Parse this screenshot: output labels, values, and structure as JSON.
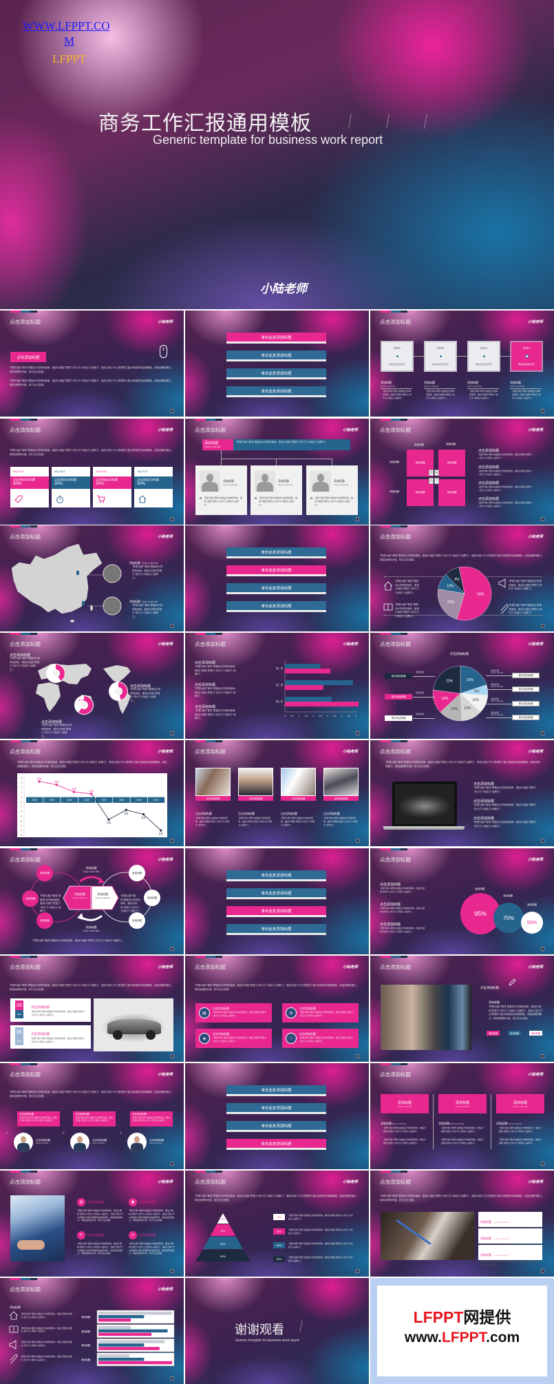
{
  "cover": {
    "link_line1": "WWW.LFPPT.CO",
    "link_line2": "M",
    "brand": "LFPPT",
    "title": "商务工作汇报通用模板",
    "subtitle": "Generic template for business work report",
    "logo": "小陆老师"
  },
  "colors": {
    "pink": "#e8288f",
    "blue": "#26648e",
    "navy": "#1e2a40",
    "grey": "#b5b5b5",
    "light_blue": "#a9d8f5"
  },
  "common": {
    "slide_title": "点击添加标题",
    "logo": "小陆老师",
    "body": "“思想为客户服务”是做设计的神圣使命。做设计相信“思想力+执行力+持续力+品牌力”，做设计致力于以思想的力量为所服务的品牌增值，成就品牌的魅力，释放品牌的价值，助力企业发展。",
    "body_short": "“思想为客户服务”是做设计的神圣使命。做设计相信“思想力+执行力+持续力+品牌力”。",
    "add_title": "添加标题",
    "click_add": "Click to add title",
    "click_title": "点击添加标题",
    "single_click": "单击添加标题",
    "add_text": "单击此处添加文字"
  },
  "section": {
    "items": [
      "单击此处添加标题",
      "单击此处添加标题",
      "单击此处添加标题",
      "单击此处添加标题"
    ],
    "active_by_slide": [
      0,
      1,
      2,
      3
    ]
  },
  "timeline": {
    "years": [
      "2007",
      "2010",
      "2012",
      "2014"
    ],
    "active": 3
  },
  "cards4": {
    "dates": [
      "May 2013",
      "May 2013",
      "June 2013",
      "July 2013"
    ],
    "label": "点击添加文本标题",
    "value": "30%",
    "icons": [
      "tag-icon",
      "stopwatch-icon",
      "cart-icon",
      "home-icon"
    ]
  },
  "swot": {
    "letters": [
      "S",
      "W",
      "O",
      "T"
    ]
  },
  "map_donuts": {
    "values": [
      "40%",
      "60%",
      "45%"
    ]
  },
  "pie1": {
    "values": [
      58,
      23,
      10,
      9
    ],
    "labels": [
      "58%",
      "23%",
      "10%",
      "9%"
    ]
  },
  "bar_chart": {
    "categories": [
      "第一项",
      "第二项",
      "第三项"
    ],
    "series": [
      {
        "values": [
          2.5,
          4.8,
          3.3
        ]
      },
      {
        "values": [
          3.2,
          2.7,
          5.2
        ]
      }
    ],
    "ticks": [
      "0",
      "0.5",
      "1",
      "1.5",
      "2",
      "2.5",
      "3",
      "3.5",
      "4",
      "4.5",
      "5"
    ],
    "xlim": [
      0,
      5
    ]
  },
  "pie2": {
    "values": [
      20,
      6,
      11,
      12,
      14,
      14,
      23
    ],
    "labels": [
      "20%",
      "6%",
      "11%",
      "12%",
      "14%",
      "14%",
      "23%"
    ]
  },
  "line_chart": {
    "years": [
      "2003",
      "2004",
      "2005",
      "2006",
      "2007",
      "2008",
      "2009",
      "2010"
    ],
    "values": [
      3.3,
      2.6,
      1.1,
      0.7,
      -4.7,
      -2.7,
      -3.6,
      -7
    ],
    "point_label": "文本",
    "y_ticks": [
      "4",
      "3",
      "2",
      "1",
      "0",
      "-1",
      "-2",
      "-3",
      "-4",
      "-5",
      "-6",
      "-7",
      "-8"
    ],
    "ylim": [
      -8,
      4
    ]
  },
  "circles": {
    "values": [
      "95%",
      "70%",
      "50%"
    ]
  },
  "dates": {
    "items": [
      {
        "day": "05",
        "month": "DEC"
      },
      {
        "day": "06",
        "month": "DEC"
      }
    ]
  },
  "pyramid": {
    "labels": [
      "2%",
      "8%",
      "40%",
      "50%"
    ]
  },
  "grouped_bars": {
    "rows": [
      {
        "grey": 1.0,
        "blue": 0.62,
        "pink": 0.44
      },
      {
        "grey": 0.44,
        "blue": 0.94,
        "pink": 0.72
      },
      {
        "grey": 0.9,
        "blue": 0.62,
        "pink": 0.83
      },
      {
        "grey": 0.42,
        "blue": 0.62,
        "pink": 1.0
      }
    ]
  },
  "thanks": {
    "title": "谢谢观看",
    "subtitle": "Generic template for business work report"
  },
  "promo": {
    "line1_a": "LFPPT",
    "line1_b": "网提供",
    "line2_a": "www.",
    "line2_b": "LFPPT",
    ".com": ".com",
    "line2_c": ".com"
  }
}
